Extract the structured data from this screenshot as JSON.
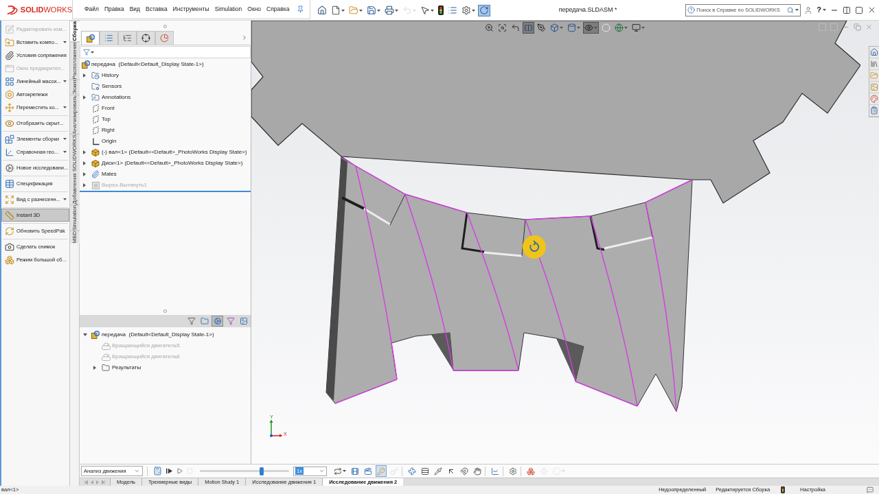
{
  "window": {
    "title": "передача.SLDASM *"
  },
  "logo": {
    "text": "**SOLID**WORKS"
  },
  "menu": [
    "Файл",
    "Правка",
    "Вид",
    "Вставка",
    "Инструменты",
    "Simulation",
    "Окно",
    "Справка"
  ],
  "quick_access": [
    {
      "pressed": false,
      "disabled": false,
      "dropdown": false
    },
    {
      "pressed": false,
      "disabled": false,
      "dropdown": true
    },
    {
      "pressed": false,
      "disabled": false,
      "dropdown": true
    },
    {
      "pressed": false,
      "disabled": false,
      "dropdown": true
    },
    {
      "pressed": false,
      "disabled": false,
      "dropdown": true
    },
    {
      "pressed": false,
      "disabled": true,
      "dropdown": true
    },
    {
      "pressed": false,
      "disabled": false,
      "dropdown": true
    },
    {
      "pressed": false,
      "disabled": false,
      "dropdown": false
    },
    {
      "pressed": false,
      "disabled": false,
      "dropdown": false
    },
    {
      "pressed": false,
      "disabled": false,
      "dropdown": true
    },
    {
      "pressed": true,
      "disabled": false,
      "dropdown": false
    }
  ],
  "search": {
    "placeholder": "Поиск в Справке по SOLIDWORKS"
  },
  "help": "?",
  "command_manager": {
    "groups": [
      {
        "items": [
          {
            "label": "Редактировать ком...",
            "disabled": true,
            "dropdown": false,
            "pressed": false
          },
          {
            "label": "Вставить компо...",
            "disabled": false,
            "dropdown": true,
            "pressed": false
          },
          {
            "label": "Условия сопряжения",
            "disabled": false,
            "dropdown": false,
            "pressed": false
          },
          {
            "label": "Окно предварител...",
            "disabled": true,
            "dropdown": false,
            "pressed": false
          },
          {
            "label": "Линейный масси...",
            "disabled": false,
            "dropdown": true,
            "pressed": false
          },
          {
            "label": "Автокрепежи",
            "disabled": false,
            "dropdown": false,
            "pressed": false
          },
          {
            "label": "Переместить ко...",
            "disabled": false,
            "dropdown": true,
            "pressed": false
          }
        ]
      },
      {
        "items": [
          {
            "label": "Отобразить скрыт...",
            "disabled": false,
            "dropdown": false,
            "pressed": false
          }
        ]
      },
      {
        "items": [
          {
            "label": "Элементы сборки",
            "disabled": false,
            "dropdown": true,
            "pressed": false
          },
          {
            "label": "Справочная гео...",
            "disabled": false,
            "dropdown": true,
            "pressed": false
          }
        ]
      },
      {
        "items": [
          {
            "label": "Новое исследовани...",
            "disabled": false,
            "dropdown": false,
            "pressed": false
          }
        ]
      },
      {
        "items": [
          {
            "label": "Спецификация",
            "disabled": false,
            "dropdown": false,
            "pressed": false
          }
        ]
      },
      {
        "items": [
          {
            "label": "Вид с разнесенн...",
            "disabled": false,
            "dropdown": true,
            "pressed": false
          }
        ]
      },
      {
        "items": [
          {
            "label": "Instant 3D",
            "disabled": false,
            "dropdown": false,
            "pressed": true
          }
        ]
      },
      {
        "items": [
          {
            "label": "Обновить SpeedPak",
            "disabled": false,
            "dropdown": false,
            "pressed": false
          }
        ]
      },
      {
        "items": [
          {
            "label": "Сделать снимок",
            "disabled": false,
            "dropdown": false,
            "pressed": false
          },
          {
            "label": "Режим большой сб...",
            "disabled": false,
            "dropdown": false,
            "pressed": false
          }
        ]
      }
    ]
  },
  "vertical_tabs": [
    {
      "label": "Сборка",
      "selected": true
    },
    {
      "label": "Расположение",
      "selected": false
    },
    {
      "label": "Эскиз",
      "selected": false
    },
    {
      "label": "Анализировать",
      "selected": false
    },
    {
      "label": "Добавления SOLIDWORKS",
      "selected": false
    },
    {
      "label": "Simulation",
      "selected": false
    },
    {
      "label": "MBD",
      "selected": false
    }
  ],
  "feature_tree": {
    "panel_tabs": [
      {
        "selected": true
      },
      {
        "selected": false
      },
      {
        "selected": false
      },
      {
        "selected": false
      },
      {
        "selected": false
      }
    ],
    "root": {
      "label": "передача  (Default<Default_Display State-1>)",
      "children": [
        {
          "label": "History",
          "kind": "history",
          "expandable": true,
          "disabled": false
        },
        {
          "label": "Sensors",
          "kind": "sensors",
          "expandable": false,
          "disabled": false
        },
        {
          "label": "Annotations",
          "kind": "annotations",
          "expandable": true,
          "disabled": false
        },
        {
          "label": "Front",
          "kind": "plane",
          "expandable": false,
          "disabled": false
        },
        {
          "label": "Top",
          "kind": "plane",
          "expandable": false,
          "disabled": false
        },
        {
          "label": "Right",
          "kind": "plane",
          "expandable": false,
          "disabled": false
        },
        {
          "label": "Origin",
          "kind": "origin",
          "expandable": false,
          "disabled": false
        },
        {
          "label": "(-) вал<1> (Default<<Default>_PhotoWorks Display State>)",
          "kind": "component",
          "expandable": true,
          "disabled": false
        },
        {
          "label": "Диск<1> (Default<<Default>_PhotoWorks Display State>)",
          "kind": "component",
          "expandable": true,
          "disabled": false
        },
        {
          "label": "Mates",
          "kind": "mates",
          "expandable": true,
          "disabled": false
        },
        {
          "label": "Вырез-Вытянуть1",
          "kind": "feature",
          "expandable": true,
          "disabled": true
        }
      ]
    }
  },
  "motion_tree": {
    "toolbar": [
      {
        "pressed": false
      },
      {
        "pressed": false
      },
      {
        "pressed": true
      },
      {
        "pressed": false
      },
      {
        "pressed": false
      }
    ],
    "root": {
      "label": "передача  (Default<Default_Display State-1>)",
      "expanded": true,
      "children": [
        {
          "label": "Вращающийся двигатель5",
          "kind": "motor",
          "expandable": false,
          "disabled": true
        },
        {
          "label": "Вращающийся двигатель6",
          "kind": "motor",
          "expandable": false,
          "disabled": true
        },
        {
          "label": "Результаты",
          "kind": "results",
          "expandable": true,
          "disabled": false
        }
      ]
    }
  },
  "view_toolbar": [
    {
      "pressed": false,
      "disabled": false,
      "dropdown": false
    },
    {
      "pressed": false,
      "disabled": false,
      "dropdown": false
    },
    {
      "pressed": false,
      "disabled": false,
      "dropdown": false
    },
    {
      "pressed": true,
      "disabled": false,
      "dropdown": false
    },
    {
      "pressed": false,
      "disabled": false,
      "dropdown": false
    },
    {
      "pressed": false,
      "disabled": false,
      "dropdown": true
    },
    {
      "pressed": false,
      "disabled": false,
      "dropdown": true
    },
    {
      "pressed": true,
      "disabled": false,
      "dropdown": true
    },
    {
      "pressed": false,
      "disabled": true,
      "dropdown": false
    },
    {
      "pressed": false,
      "disabled": false,
      "dropdown": true
    },
    {
      "pressed": false,
      "disabled": false,
      "dropdown": true
    }
  ],
  "triad": {
    "x_label": "X",
    "y_label": "Y"
  },
  "motion_manager": {
    "study_type": "Анализ движения",
    "playback_buttons": [
      {
        "disabled": false
      },
      {
        "disabled": false
      },
      {
        "disabled": false
      },
      {
        "disabled": true
      }
    ],
    "timeline": {
      "level": 0.69
    },
    "speed": {
      "value": "1x",
      "highlighted": true
    },
    "tool_groups": [
      {
        "items": [
          {
            "pressed": false,
            "disabled": false,
            "dropdown": true
          },
          {
            "pressed": false,
            "disabled": false,
            "dropdown": false
          },
          {
            "pressed": false,
            "disabled": false,
            "dropdown": false
          },
          {
            "pressed": true,
            "disabled": false,
            "dropdown": false
          },
          {
            "pressed": false,
            "disabled": true,
            "dropdown": false
          }
        ]
      },
      {
        "items": [
          {
            "pressed": false,
            "disabled": false,
            "dropdown": false
          },
          {
            "pressed": false,
            "disabled": false,
            "dropdown": false
          },
          {
            "pressed": false,
            "disabled": false,
            "dropdown": false
          },
          {
            "pressed": false,
            "disabled": false,
            "dropdown": false
          },
          {
            "pressed": false,
            "disabled": false,
            "dropdown": false
          },
          {
            "pressed": false,
            "disabled": false,
            "dropdown": false
          }
        ]
      },
      {
        "items": [
          {
            "pressed": false,
            "disabled": false,
            "dropdown": false
          }
        ]
      },
      {
        "items": [
          {
            "pressed": false,
            "disabled": false,
            "dropdown": false
          }
        ]
      },
      {
        "items": [
          {
            "pressed": false,
            "disabled": false,
            "dropdown": false
          },
          {
            "pressed": false,
            "disabled": true,
            "dropdown": false
          },
          {
            "pressed": false,
            "disabled": true,
            "dropdown": true
          }
        ]
      }
    ],
    "tabs": [
      {
        "label": "Модель",
        "selected": false
      },
      {
        "label": "Трехмерные виды",
        "selected": false
      },
      {
        "label": "Motion Study 1",
        "selected": false
      },
      {
        "label": "Исследование движения 1",
        "selected": false
      },
      {
        "label": "Исследование движения 2",
        "selected": true
      }
    ]
  },
  "status_bar": {
    "selection": "вал<1>",
    "fields": [
      "Недоопределенный",
      "Редактируется Сборка"
    ],
    "units": "Настройка"
  }
}
